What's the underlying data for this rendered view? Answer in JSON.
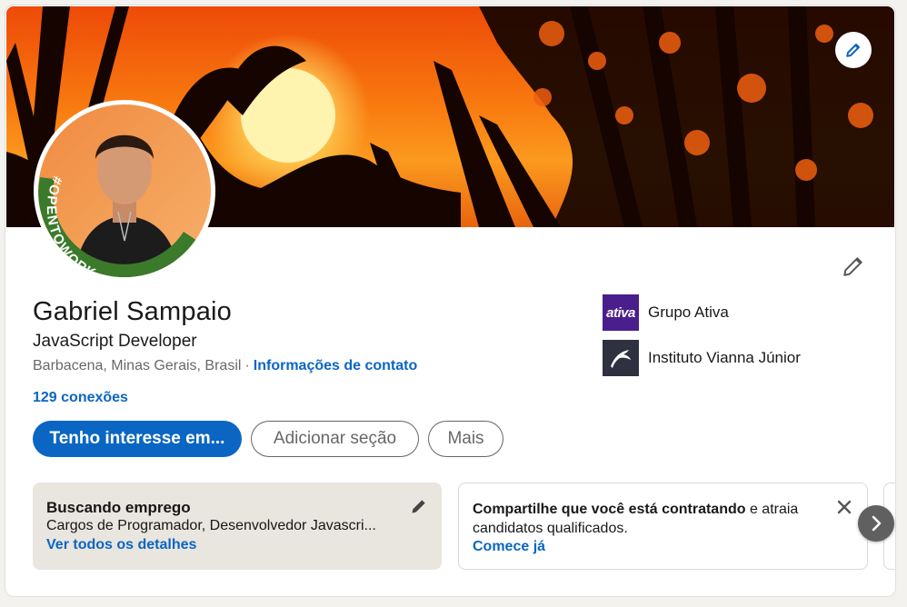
{
  "profile": {
    "name": "Gabriel Sampaio",
    "headline": "JavaScript Developer",
    "location": "Barbacena, Minas Gerais, Brasil",
    "separator": "·",
    "contact_link": "Informações de contato",
    "connections": "129 conexões",
    "open_to_work_badge": "#OPENTOWORK"
  },
  "actions": {
    "primary": "Tenho interesse em...",
    "add_section": "Adicionar seção",
    "more": "Mais"
  },
  "organizations": [
    {
      "name": "Grupo Ativa",
      "logo_text": "ativa",
      "logo_color": "#4a1e8c"
    },
    {
      "name": "Instituto Vianna Júnior",
      "logo_icon": "dolphin-icon",
      "logo_color": "#2f3140"
    }
  ],
  "open_to_work": {
    "title": "Buscando emprego",
    "subtitle": "Cargos de Programador, Desenvolvedor Javascri...",
    "link": "Ver todos os detalhes"
  },
  "hiring": {
    "text_bold": "Compartilhe que você está contratando",
    "text_rest": " e atraia candidatos qualificados.",
    "link": "Comece já"
  },
  "icons": {
    "banner_edit": "pencil-icon",
    "intro_edit": "pencil-icon",
    "panel_edit": "pencil-icon",
    "close": "close-icon",
    "next": "chevron-right-icon"
  },
  "colors": {
    "accent": "#0a66c2",
    "open_to_work_green": "#3a7a2a",
    "page_background": "#f3f2ef"
  }
}
